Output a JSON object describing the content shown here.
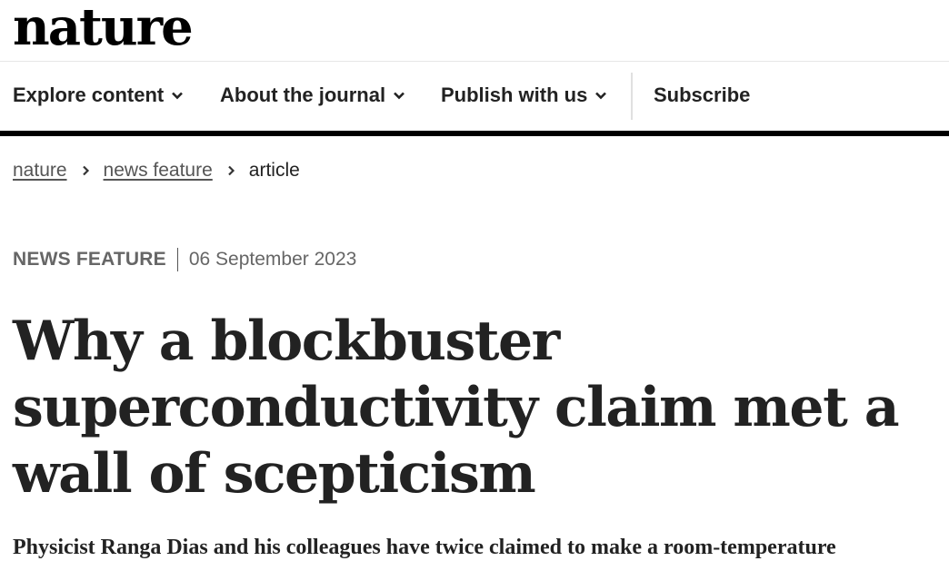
{
  "brand": {
    "logo_text": "nature"
  },
  "nav": {
    "items": [
      {
        "label": "Explore content",
        "icon": "chevron-down-icon"
      },
      {
        "label": "About the journal",
        "icon": "chevron-down-icon"
      },
      {
        "label": "Publish with us",
        "icon": "chevron-down-icon"
      }
    ],
    "subscribe_label": "Subscribe"
  },
  "breadcrumb": {
    "items": [
      "nature",
      "news feature"
    ],
    "current": "article",
    "separator_icon": "chevron-right-icon"
  },
  "article": {
    "type": "NEWS FEATURE",
    "date": "06 September 2023",
    "title": "Why a blockbuster superconductivity claim met a wall of scepticism",
    "standfirst": "Physicist Ranga Dias and his colleagues have twice claimed to make a room-temperature"
  },
  "colors": {
    "text": "#222222",
    "muted": "#666666",
    "rule": "#000000"
  }
}
